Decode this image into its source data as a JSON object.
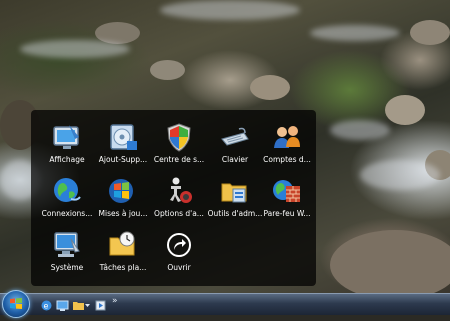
{
  "launcher": {
    "items": [
      {
        "label": "Affichage"
      },
      {
        "label": "Ajout-Supp..."
      },
      {
        "label": "Centre de s..."
      },
      {
        "label": "Clavier"
      },
      {
        "label": "Comptes d..."
      },
      {
        "label": "Connexions..."
      },
      {
        "label": "Mises à jou..."
      },
      {
        "label": "Options d'a..."
      },
      {
        "label": "Outils d'adm..."
      },
      {
        "label": "Pare-feu W..."
      },
      {
        "label": "Système"
      },
      {
        "label": "Tâches pla..."
      },
      {
        "label": "Ouvrir"
      }
    ]
  },
  "taskbar": {
    "chevron": "»"
  }
}
